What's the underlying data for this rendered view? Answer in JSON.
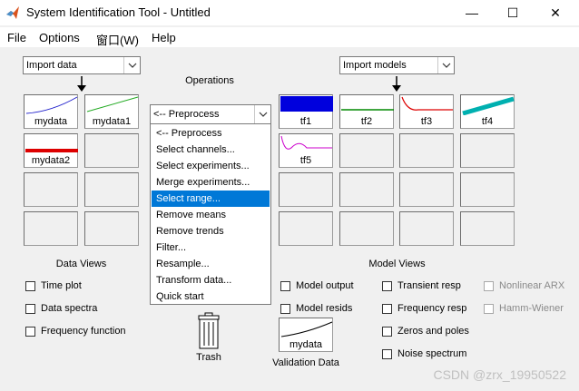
{
  "window": {
    "title": "System Identification Tool - Untitled",
    "minimize": "—",
    "maximize": "☐",
    "close": "✕"
  },
  "menu": [
    "File",
    "Options",
    "窗口(W)",
    "Help"
  ],
  "import_data": {
    "label": "Import data"
  },
  "import_models": {
    "label": "Import models"
  },
  "operations": {
    "title": "Operations",
    "selected": "<-- Preprocess",
    "options": [
      "<-- Preprocess",
      "Select channels...",
      "Select experiments...",
      "Merge experiments...",
      "Select range...",
      "Remove means",
      "Remove trends",
      "Filter...",
      "Resample...",
      "Transform data...",
      "Quick start"
    ],
    "highlighted_index": 4
  },
  "data_tiles": [
    {
      "label": "mydata",
      "color": "#2222cc"
    },
    {
      "label": "mydata1",
      "color": "#22aa22"
    },
    {
      "label": "mydata2",
      "color": "#dd0000"
    }
  ],
  "model_tiles": [
    {
      "label": "tf1",
      "color": "#0000dd"
    },
    {
      "label": "tf2",
      "color": "#008800"
    },
    {
      "label": "tf3",
      "color": "#dd0000"
    },
    {
      "label": "tf4",
      "color": "#00b0b0"
    },
    {
      "label": "tf5",
      "color": "#cc00cc"
    }
  ],
  "data_views": {
    "title": "Data Views",
    "items": [
      "Time plot",
      "Data spectra",
      "Frequency function"
    ]
  },
  "model_views": {
    "title": "Model Views",
    "items_col1": [
      "Model output",
      "Model resids"
    ],
    "items_col2": [
      "Transient resp",
      "Frequency resp",
      "Zeros and poles",
      "Noise spectrum"
    ],
    "items_col3": [
      "Nonlinear ARX",
      "Hamm-Wiener"
    ]
  },
  "trash": {
    "label": "Trash"
  },
  "validation": {
    "tile_label": "mydata",
    "label": "Validation Data"
  },
  "watermark": "CSDN @zrx_19950522"
}
